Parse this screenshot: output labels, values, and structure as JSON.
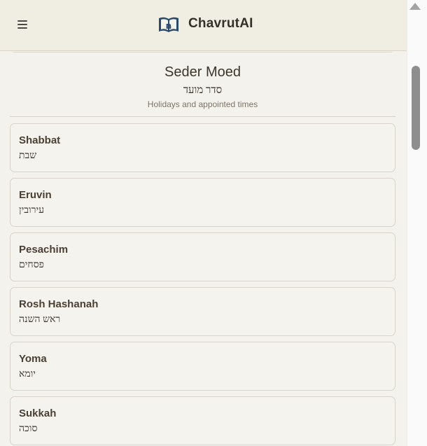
{
  "header": {
    "app_title": "ChavrutAI",
    "logo_glyph": "ח",
    "menu_icon": "hamburger-menu-icon",
    "logo_icon": "open-book-icon"
  },
  "section": {
    "title": "Seder Moed",
    "hebrew": "סדר מועד",
    "subtitle": "Holidays and appointed times"
  },
  "tractates": [
    {
      "name": "Shabbat",
      "hebrew": "שבת"
    },
    {
      "name": "Eruvin",
      "hebrew": "עירובין"
    },
    {
      "name": "Pesachim",
      "hebrew": "פסחים"
    },
    {
      "name": "Rosh Hashanah",
      "hebrew": "ראש השנה"
    },
    {
      "name": "Yoma",
      "hebrew": "יומא"
    },
    {
      "name": "Sukkah",
      "hebrew": "סוכה"
    }
  ],
  "colors": {
    "background": "#f4f2ec",
    "header_bg": "#f0ede3",
    "logo_blue": "#2b4a6b"
  }
}
